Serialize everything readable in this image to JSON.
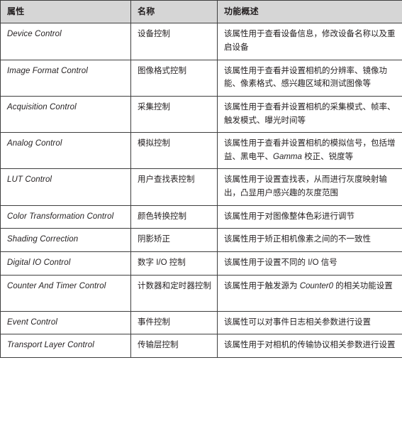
{
  "table": {
    "headers": [
      {
        "key": "attribute",
        "label": "属性"
      },
      {
        "key": "name",
        "label": "名称"
      },
      {
        "key": "description",
        "label": "功能概述"
      }
    ],
    "rows": [
      {
        "key": "device",
        "attribute": "Device Control",
        "name": "设备控制",
        "description": "该属性用于查看设备信息，修改设备名称以及重启设备"
      },
      {
        "key": "image-format",
        "attribute": "Image Format Control",
        "name": "图像格式控制",
        "description": "该属性用于查看并设置相机的分辨率、镜像功能、像素格式、感兴趣区域和测试图像等"
      },
      {
        "key": "acquisition",
        "attribute": "Acquisition Control",
        "name": "采集控制",
        "description": "该属性用于查看并设置相机的采集模式、帧率、触发模式、曝光时间等"
      },
      {
        "key": "analog",
        "attribute": "Analog Control",
        "name": "模拟控制",
        "description": "该属性用于查看并设置相机的模拟信号，包括增益、黑电平、Gamma 校正、锐度等"
      },
      {
        "key": "lut",
        "attribute": "LUT Control",
        "name": "用户查找表控制",
        "description": "该属性用于设置查找表，从而进行灰度映射输出，凸显用户感兴趣的灰度范围"
      },
      {
        "key": "color-transformation",
        "attribute": "Color Transformation Control",
        "name": "颜色转换控制",
        "description": "该属性用于对图像整体色彩进行调节"
      },
      {
        "key": "shading",
        "attribute": "Shading Correction",
        "name": "阴影矫正",
        "description": "该属性用于矫正相机像素之间的不一致性"
      },
      {
        "key": "digital-io",
        "attribute": "Digital IO Control",
        "name": "数字 I/O 控制",
        "description": "该属性用于设置不同的 I/O 信号"
      },
      {
        "key": "counter",
        "attribute": "Counter And Timer Control",
        "name": "计数器和定时器控制",
        "description": "该属性用于触发源为 Counter0 的相关功能设置"
      },
      {
        "key": "event",
        "attribute": "Event Control",
        "name": "事件控制",
        "description": "该属性可以对事件日志相关参数进行设置"
      },
      {
        "key": "transport-layer",
        "attribute": "Transport Layer Control",
        "name": "传输层控制",
        "description": "该属性用于对相机的传输协议相关参数进行设置"
      }
    ]
  },
  "colors": {
    "header_background": "#d6d6d6",
    "border": "#3f3f3f",
    "text": "#231f20",
    "page_background": "#ffffff"
  }
}
